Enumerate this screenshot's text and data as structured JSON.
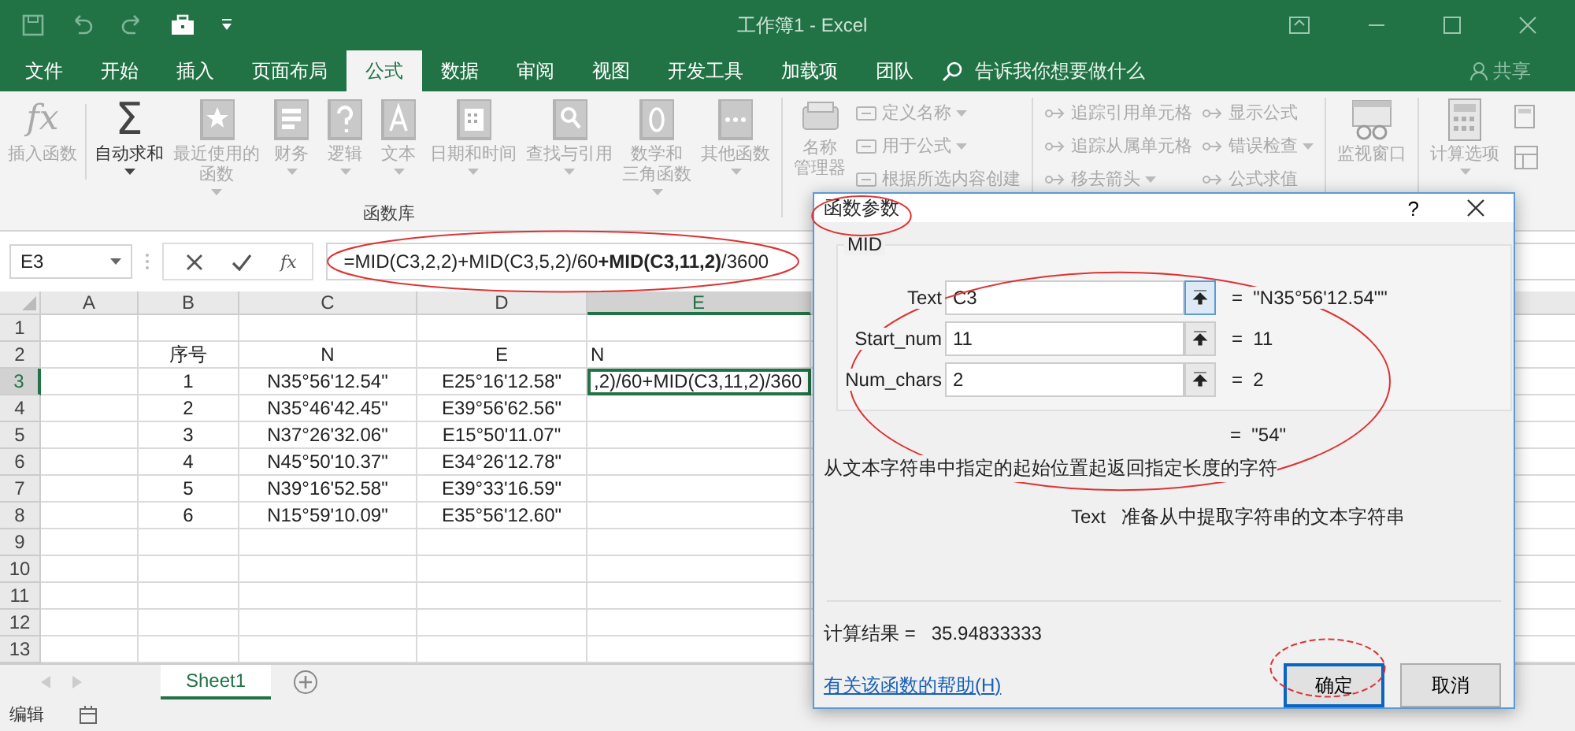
{
  "window": {
    "title": "工作簿1 - Excel"
  },
  "ribbon_tabs": [
    {
      "label": "文件",
      "selected": false
    },
    {
      "label": "开始",
      "selected": false
    },
    {
      "label": "插入",
      "selected": false
    },
    {
      "label": "页面布局",
      "selected": false
    },
    {
      "label": "公式",
      "selected": true
    },
    {
      "label": "数据",
      "selected": false
    },
    {
      "label": "审阅",
      "selected": false
    },
    {
      "label": "视图",
      "selected": false
    },
    {
      "label": "开发工具",
      "selected": false
    },
    {
      "label": "加载项",
      "selected": false
    },
    {
      "label": "团队",
      "selected": false
    }
  ],
  "tell_me": {
    "placeholder": "告诉我你想要做什么"
  },
  "share": {
    "label": "共享"
  },
  "function_library": {
    "label": "函数库",
    "buttons": [
      {
        "kind": "fx",
        "icon_text": "fx",
        "lines": [
          "插入函数"
        ],
        "disabled": true,
        "dropdown": false
      },
      {
        "kind": "sigma",
        "icon_text": "Σ",
        "lines": [
          "自动求和"
        ],
        "disabled": false,
        "dropdown": true
      },
      {
        "kind": "star",
        "lines": [
          "最近使用的",
          "函数"
        ],
        "disabled": true,
        "dropdown": true
      },
      {
        "kind": "ledger",
        "lines": [
          "财务"
        ],
        "disabled": true,
        "dropdown": true
      },
      {
        "kind": "question",
        "lines": [
          "逻辑"
        ],
        "disabled": true,
        "dropdown": true
      },
      {
        "kind": "letter",
        "lines": [
          "文本"
        ],
        "disabled": true,
        "dropdown": true
      },
      {
        "kind": "calendar",
        "lines": [
          "日期和时间"
        ],
        "disabled": true,
        "dropdown": true
      },
      {
        "kind": "magnifier",
        "lines": [
          "查找与引用"
        ],
        "disabled": true,
        "dropdown": true
      },
      {
        "kind": "theta",
        "lines": [
          "数学和",
          "三角函数"
        ],
        "disabled": true,
        "dropdown": true
      },
      {
        "kind": "dots",
        "lines": [
          "其他函数"
        ],
        "disabled": true,
        "dropdown": true
      }
    ]
  },
  "defined_names": {
    "big_button": {
      "lines": [
        "名称",
        "管理器"
      ],
      "disabled": true
    },
    "items": [
      {
        "label": "定义名称",
        "dropdown": true,
        "disabled": true
      },
      {
        "label": "用于公式",
        "dropdown": true,
        "disabled": true
      },
      {
        "label": "根据所选内容创建",
        "dropdown": false,
        "disabled": true
      }
    ]
  },
  "formula_auditing": {
    "columns": [
      [
        {
          "label": "追踪引用单元格",
          "dropdown": false,
          "disabled": true
        },
        {
          "label": "追踪从属单元格",
          "dropdown": false,
          "disabled": true
        },
        {
          "label": "移去箭头",
          "dropdown": true,
          "disabled": true
        }
      ],
      [
        {
          "label": "显示公式",
          "dropdown": false,
          "disabled": true
        },
        {
          "label": "错误检查",
          "dropdown": true,
          "disabled": true
        },
        {
          "label": "公式求值",
          "dropdown": false,
          "disabled": true
        }
      ]
    ]
  },
  "watch_window": {
    "lines": [
      "监视窗口"
    ],
    "disabled": true
  },
  "calculation": {
    "lines": [
      "计算选项"
    ],
    "disabled": true,
    "dropdown": true
  },
  "formula_bar": {
    "name_box": "E3",
    "formula": "=MID(C3,2,2)+MID(C3,5,2)/60**+MID(C3,11,2)**/3600",
    "fx": "fx"
  },
  "columns": [
    {
      "label": "A",
      "selected": false
    },
    {
      "label": "B",
      "selected": false
    },
    {
      "label": "C",
      "selected": false
    },
    {
      "label": "D",
      "selected": false
    },
    {
      "label": "E",
      "selected": true
    }
  ],
  "rows": [
    {
      "label": "1",
      "selected": false,
      "cells": {}
    },
    {
      "label": "2",
      "selected": false,
      "cells": {
        "B": "序号",
        "C": "N",
        "D": "E",
        "E": "N"
      }
    },
    {
      "label": "3",
      "selected": true,
      "cells": {
        "B": "1",
        "C": "N35°56'12.54\"",
        "D": "E25°16'12.58\"",
        "E": ",2)/60+MID(C3,11,2)/360"
      }
    },
    {
      "label": "4",
      "selected": false,
      "cells": {
        "B": "2",
        "C": "N35°46'42.45\"",
        "D": "E39°56'62.56\""
      }
    },
    {
      "label": "5",
      "selected": false,
      "cells": {
        "B": "3",
        "C": "N37°26'32.06\"",
        "D": "E15°50'11.07\""
      }
    },
    {
      "label": "6",
      "selected": false,
      "cells": {
        "B": "4",
        "C": "N45°50'10.37\"",
        "D": "E34°26'12.78\""
      }
    },
    {
      "label": "7",
      "selected": false,
      "cells": {
        "B": "5",
        "C": "N39°16'52.58\"",
        "D": "E39°33'16.59\""
      }
    },
    {
      "label": "8",
      "selected": false,
      "cells": {
        "B": "6",
        "C": "N15°59'10.09\"",
        "D": "E35°56'12.60\""
      }
    },
    {
      "label": "9",
      "selected": false,
      "cells": {}
    },
    {
      "label": "10",
      "selected": false,
      "cells": {}
    },
    {
      "label": "11",
      "selected": false,
      "cells": {}
    },
    {
      "label": "12",
      "selected": false,
      "cells": {}
    },
    {
      "label": "13",
      "selected": false,
      "cells": {}
    }
  ],
  "sheet_tabs": [
    {
      "label": "Sheet1",
      "selected": true
    }
  ],
  "status_bar": {
    "mode": "编辑"
  },
  "dialog": {
    "title": "函数参数",
    "help": "?",
    "function": "MID",
    "arguments": [
      {
        "label": "Text",
        "value": "C3",
        "result": "=  \"N35°56'12.54\"\"",
        "focused": true
      },
      {
        "label": "Start_num",
        "value": "11",
        "result": "=  11",
        "focused": false
      },
      {
        "label": "Num_chars",
        "value": "2",
        "result": "=  2",
        "focused": false
      }
    ],
    "result": "=  \"54\"",
    "description": "从文本字符串中指定的起始位置起返回指定长度的字符",
    "argument_help": "Text   准备从中提取字符串的文本字符串",
    "calc_result": "计算结果 =   35.94833333",
    "help_link": "有关该函数的帮助(H)",
    "buttons": [
      {
        "label": "确定",
        "default": true
      },
      {
        "label": "取消",
        "default": false
      }
    ]
  }
}
